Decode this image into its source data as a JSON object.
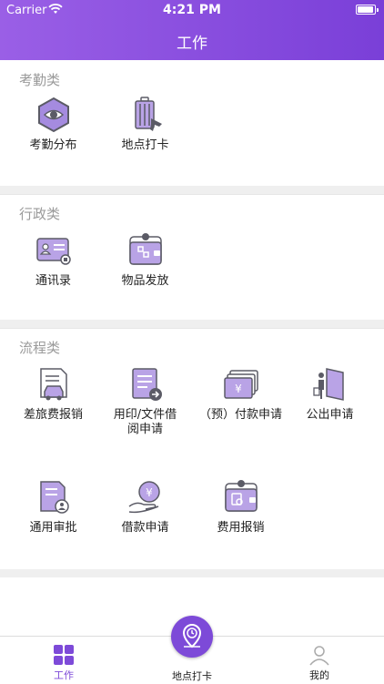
{
  "status": {
    "carrier": "Carrier",
    "time": "4:21 PM"
  },
  "header": {
    "title": "工作"
  },
  "sections": [
    {
      "title": "考勤类",
      "items": [
        {
          "label": "考勤分布",
          "icon": "eye-hexagon-icon"
        },
        {
          "label": "地点打卡",
          "icon": "luggage-plane-icon"
        }
      ]
    },
    {
      "title": "行政类",
      "items": [
        {
          "label": "通讯录",
          "icon": "contact-card-icon"
        },
        {
          "label": "物品发放",
          "icon": "item-wallet-icon"
        }
      ]
    },
    {
      "title": "流程类",
      "items": [
        {
          "label": "差旅费报销",
          "icon": "travel-car-document-icon"
        },
        {
          "label": "用印/文件借\n阅申请",
          "icon": "document-arrow-icon"
        },
        {
          "label": "（预）付款申请",
          "icon": "yen-cash-stack-icon"
        },
        {
          "label": "公出申请",
          "icon": "door-person-icon"
        },
        {
          "label": "通用审批",
          "icon": "approval-document-person-icon"
        },
        {
          "label": "借款申请",
          "icon": "yen-hand-icon"
        },
        {
          "label": "费用报销",
          "icon": "expense-wallet-icon"
        }
      ]
    }
  ],
  "tabbar": {
    "tabs": [
      {
        "label": "工作",
        "icon": "grid-icon",
        "active": true
      },
      {
        "label": "地点打卡",
        "icon": "location-clock-icon",
        "active": false
      },
      {
        "label": "我的",
        "icon": "person-icon",
        "active": false
      }
    ]
  },
  "colors": {
    "accent": "#7d4ad8",
    "icon_light": "#b9a3e6",
    "icon_dark": "#5b5b66",
    "section_title": "#9a9a9a",
    "gap": "#efefef"
  }
}
